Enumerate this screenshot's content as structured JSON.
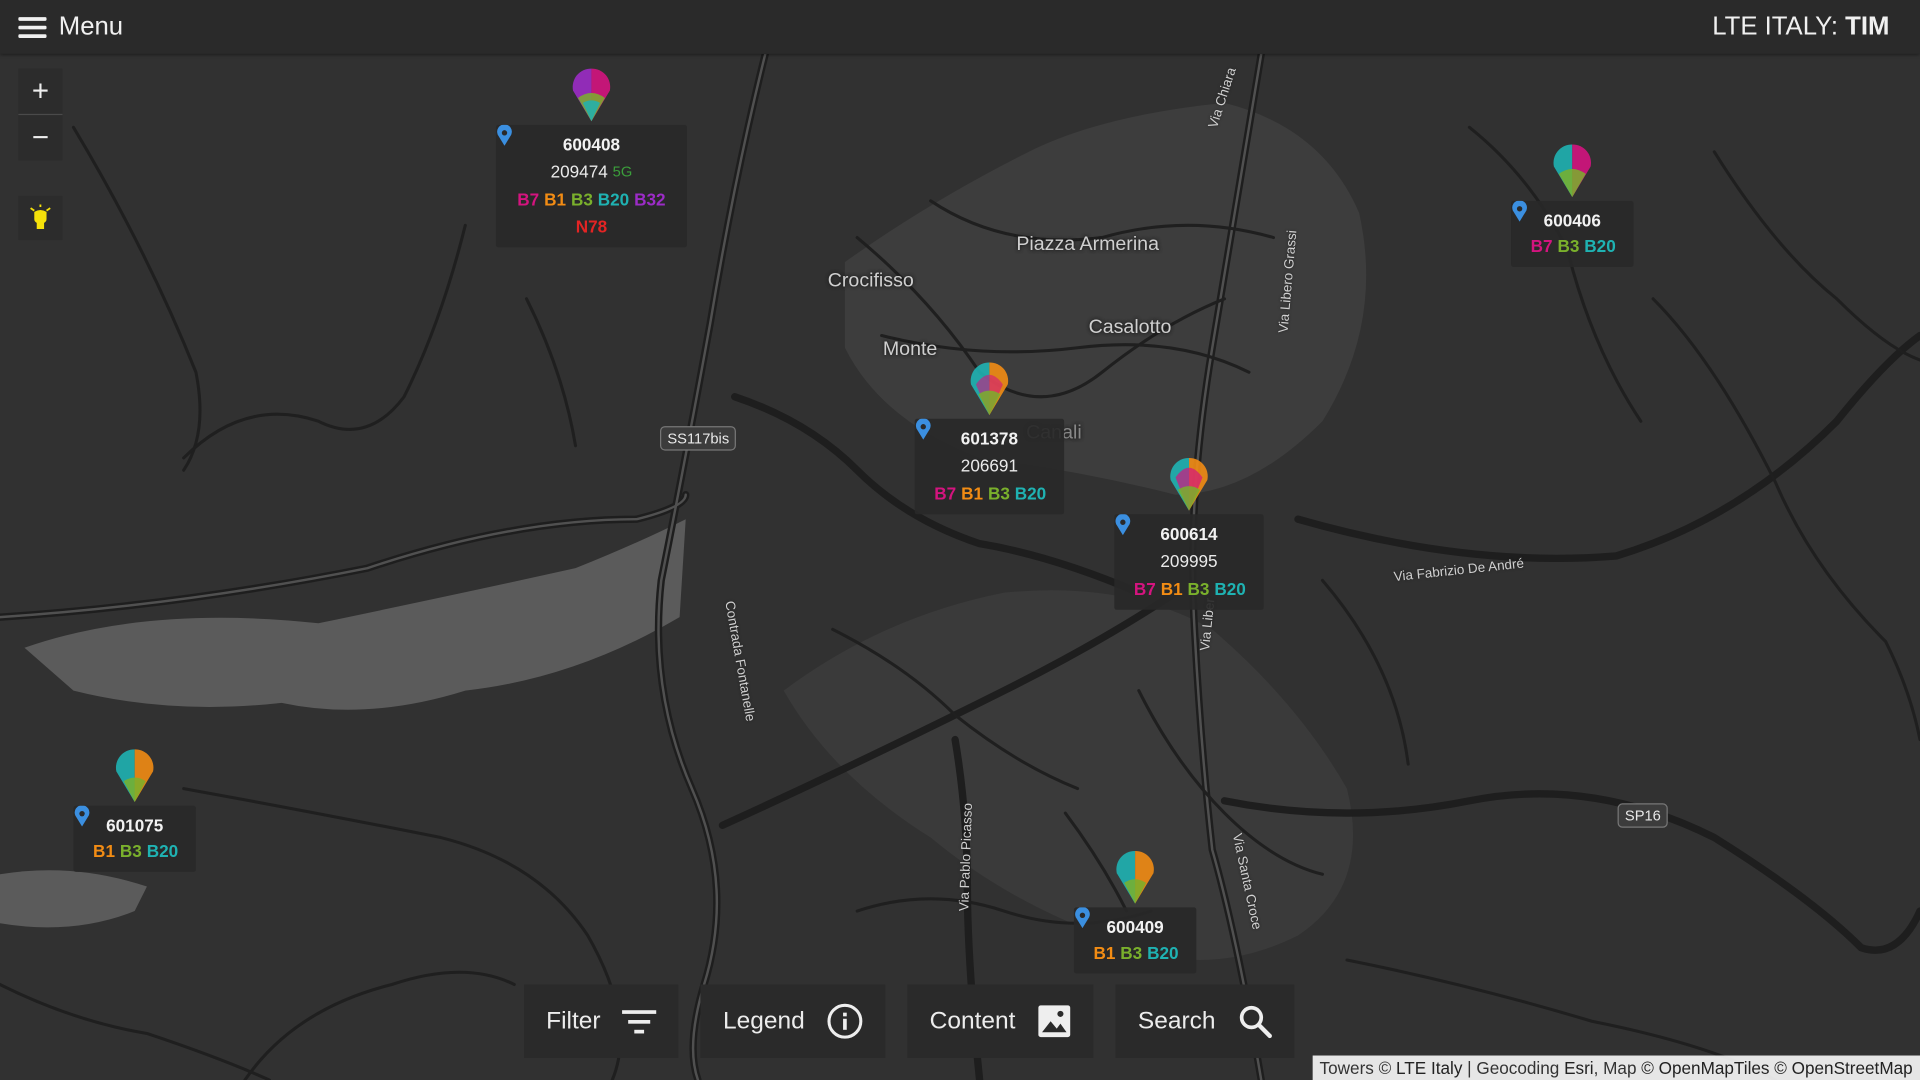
{
  "header": {
    "menu_label": "Menu",
    "title_prefix": "LTE ITALY:",
    "title_operator": "TIM"
  },
  "zoom": {
    "in_label": "+",
    "out_label": "−"
  },
  "places": [
    "Piazza Armerina",
    "Crocifisso",
    "Casalotto",
    "Monte",
    "Canali"
  ],
  "roads": [
    "Via Chiara",
    "Via Libero Grassi",
    "Via Fabrizio De André",
    "Contrada Fontanelle",
    "Via Pablo Picasso",
    "Via Santa Croce",
    "Via Liber"
  ],
  "shields": [
    "SS117bis",
    "SP16"
  ],
  "towers": [
    {
      "id": "600408",
      "cell": "209474",
      "tech": "5G",
      "bands": [
        "B7",
        "B1",
        "B3",
        "B20",
        "B32"
      ],
      "bands2": [
        "N78"
      ]
    },
    {
      "id": "600406",
      "cell": "",
      "tech": "",
      "bands": [
        "B7",
        "B3",
        "B20"
      ],
      "bands2": []
    },
    {
      "id": "601378",
      "cell": "206691",
      "tech": "",
      "bands": [
        "B7",
        "B1",
        "B3",
        "B20"
      ],
      "bands2": []
    },
    {
      "id": "600614",
      "cell": "209995",
      "tech": "",
      "bands": [
        "B7",
        "B1",
        "B3",
        "B20"
      ],
      "bands2": []
    },
    {
      "id": "601075",
      "cell": "",
      "tech": "",
      "bands": [
        "B1",
        "B3",
        "B20"
      ],
      "bands2": []
    },
    {
      "id": "600409",
      "cell": "",
      "tech": "",
      "bands": [
        "B1",
        "B3",
        "B20"
      ],
      "bands2": []
    }
  ],
  "bottom_buttons": {
    "filter": "Filter",
    "legend": "Legend",
    "content": "Content",
    "search": "Search"
  },
  "attribution": {
    "towers": "Towers ©",
    "towers_src": "LTE Italy",
    "sep": " | ",
    "geocoding": "Geocoding",
    "geocoding_src": "Esri",
    "map": ", Map",
    "tiles": "© OpenMapTiles © OpenStreetMap"
  },
  "colors": {
    "B7": "#d4147f",
    "B1": "#f28c14",
    "B3": "#7ab02c",
    "B20": "#1fb2b2",
    "B32": "#9c2cc7",
    "N78": "#e32424",
    "5G": "#3b9e3b"
  }
}
